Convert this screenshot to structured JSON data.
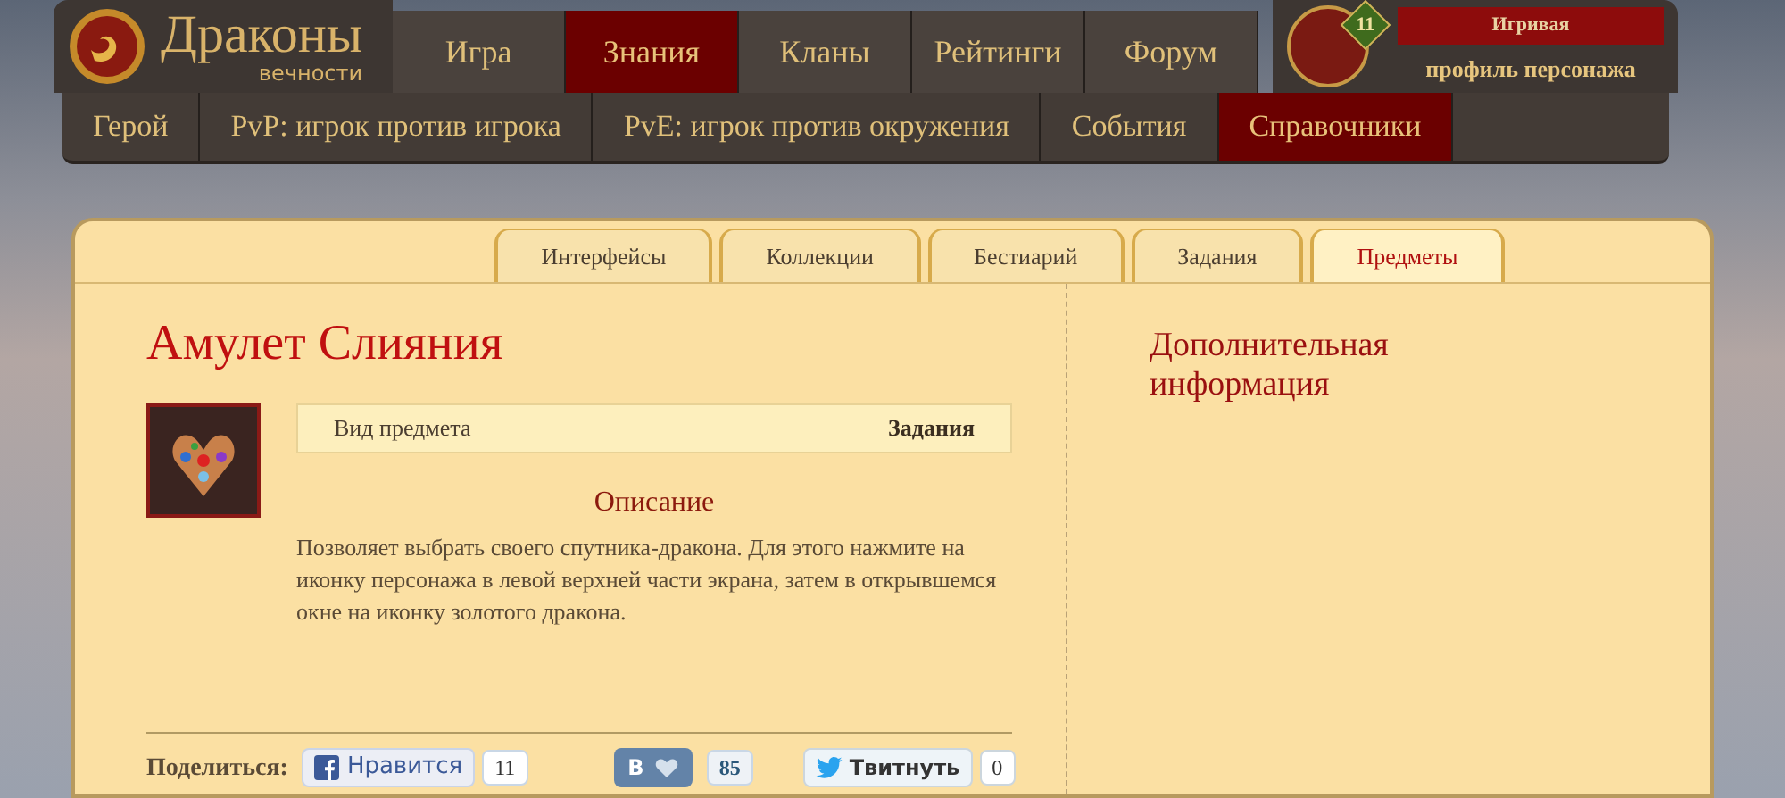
{
  "logo": {
    "title": "Драконы",
    "subtitle": "вечности"
  },
  "main_nav": [
    {
      "label": "Игра",
      "selected": false
    },
    {
      "label": "Знания",
      "selected": true
    },
    {
      "label": "Кланы",
      "selected": false
    },
    {
      "label": "Рейтинги",
      "selected": false
    },
    {
      "label": "Форум",
      "selected": false
    }
  ],
  "profile": {
    "level": "11",
    "name": "Игривая",
    "link": "профиль персонажа"
  },
  "sub_nav": [
    {
      "label": "Герой",
      "selected": false
    },
    {
      "label": "PvP: игрок против игрока",
      "selected": false
    },
    {
      "label": "PvE: игрок против окружения",
      "selected": false
    },
    {
      "label": "События",
      "selected": false
    },
    {
      "label": "Справочники",
      "selected": true
    }
  ],
  "content_tabs": [
    {
      "label": "Интерфейсы",
      "selected": false
    },
    {
      "label": "Коллекции",
      "selected": false
    },
    {
      "label": "Бестиарий",
      "selected": false
    },
    {
      "label": "Задания",
      "selected": false
    },
    {
      "label": "Предметы",
      "selected": true
    }
  ],
  "item": {
    "title": "Амулет Слияния",
    "type_label": "Вид предмета",
    "type_value": "Задания",
    "description_heading": "Описание",
    "description": "Позволяет выбрать своего спутника-дракона. Для этого нажмите на иконку персонажа в левой верхней части экрана, затем в открывшемся окне на иконку золотого дракона."
  },
  "share": {
    "label": "Поделиться:",
    "buttons": [
      {
        "kind": "facebook",
        "label": "Нравится",
        "count": "11"
      },
      {
        "kind": "vk",
        "label": "В",
        "count": "85"
      },
      {
        "kind": "twitter",
        "label": "Твитнуть",
        "count": "0"
      }
    ]
  },
  "sidebar": {
    "title": "Дополнительная информация"
  }
}
